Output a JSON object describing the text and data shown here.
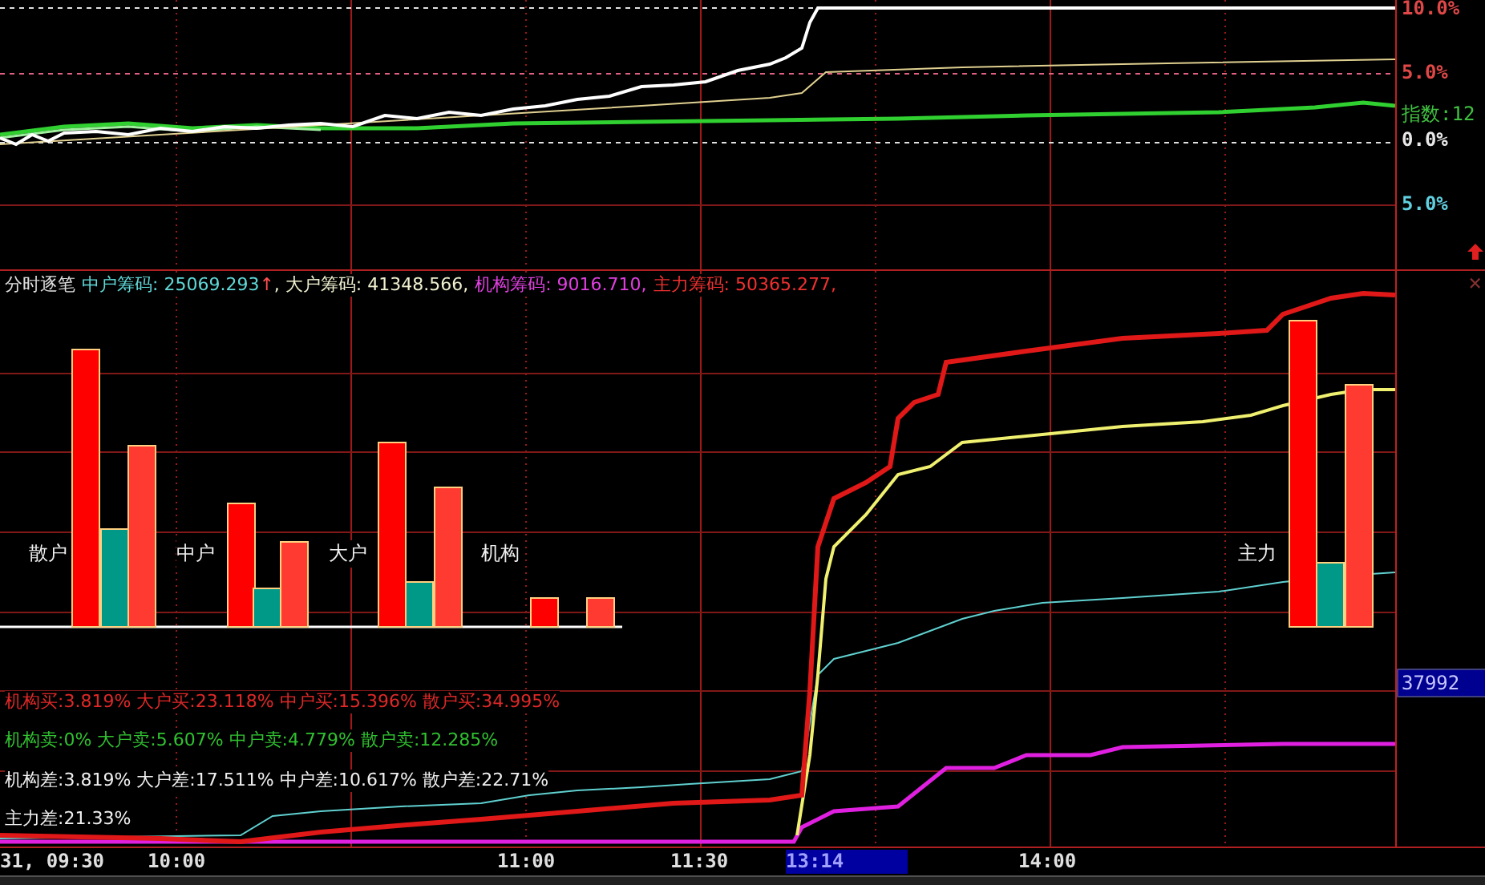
{
  "price_panel": {
    "axis_labels": [
      {
        "text": "10.0%",
        "color": "#e04848",
        "kind": "level"
      },
      {
        "text": "5.0%",
        "color": "#e04848",
        "kind": "level"
      },
      {
        "text": "指数:12",
        "color": "#40c040",
        "kind": "index"
      },
      {
        "text": "0.0%",
        "color": "#e8e8e8",
        "kind": "level"
      },
      {
        "text": "5.0%",
        "color": "#60d0e0",
        "kind": "level"
      }
    ]
  },
  "indicator_panel": {
    "title": "分时逐笔",
    "readouts": [
      {
        "text": "中户筹码: 25069.293",
        "color": "#60d8d8"
      },
      {
        "text": "↑",
        "color": "#ff5050"
      },
      {
        "text": ", 大户筹码: 41348.566,",
        "color": "#f0f0d0"
      },
      {
        "text": "机构筹码: 9016.710,",
        "color": "#e040e0"
      },
      {
        "text": "主力筹码: 50365.277,",
        "color": "#f03030"
      }
    ],
    "bar_groups": [
      {
        "label": "散户"
      },
      {
        "label": "中户"
      },
      {
        "label": "大户"
      },
      {
        "label": "机构"
      },
      {
        "label": "主力"
      }
    ],
    "stats": [
      {
        "text": "机构买:3.819% 大户买:23.118% 中户买:15.396% 散户买:34.995%",
        "color": "#e02828"
      },
      {
        "text": "机构卖:0% 大户卖:5.607% 中户卖:4.779% 散户卖:12.285%",
        "color": "#30c030"
      },
      {
        "text": "机构差:3.819% 大户差:17.511% 中户差:10.617% 散户差:22.71%",
        "color": "#f0f0f0"
      },
      {
        "text": "主力差:21.33%",
        "color": "#f0f0f0"
      }
    ],
    "cursor_value": "37992",
    "close_symbol": "×"
  },
  "time_axis": [
    {
      "label": "31, 09:30",
      "highlighted": false
    },
    {
      "label": "10:00",
      "highlighted": false
    },
    {
      "label": "11:00",
      "highlighted": false
    },
    {
      "label": "11:30",
      "highlighted": false
    },
    {
      "label": "13:14",
      "highlighted": true
    },
    {
      "label": "14:00",
      "highlighted": false
    }
  ]
}
